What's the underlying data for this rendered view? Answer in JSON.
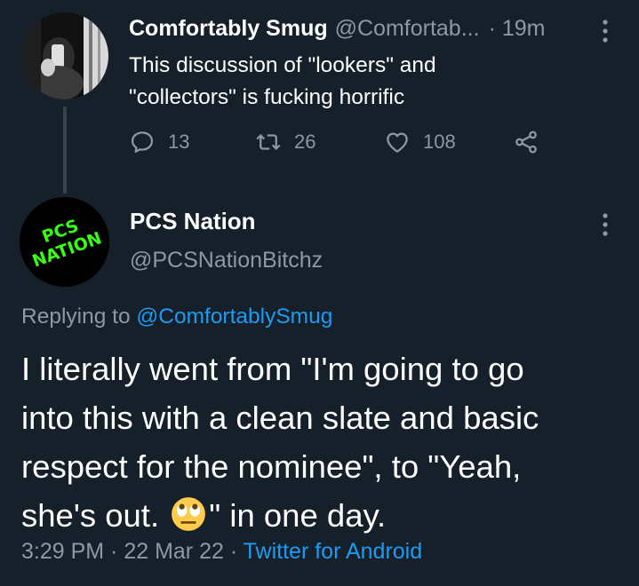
{
  "parent_tweet": {
    "display_name": "Comfortably Smug",
    "handle": "@Comfortab...",
    "time": "· 19m",
    "text_line1": "This discussion of \"lookers\" and",
    "text_line2": "\"collectors\" is fucking horrific",
    "replies": "13",
    "retweets": "26",
    "likes": "108"
  },
  "reply_tweet": {
    "display_name": "PCS Nation",
    "handle": "@PCSNationBitchz",
    "avatar_text_line1": "PCS",
    "avatar_text_line2": "NATION",
    "replying_prefix": "Replying to ",
    "replying_to": "@ComfortablySmug",
    "text_line1": "I literally went from \"I'm going to go",
    "text_line2": "into this with a clean slate and basic",
    "text_line3": "respect for the nominee\", to \"Yeah,",
    "text_line4_a": "she's out. ",
    "text_line4_b": "\" in one day.",
    "emoji": "eye-roll-emoji",
    "time": "3:29 PM",
    "separator": " · ",
    "date": "22 Mar 22",
    "source": "Twitter for Android"
  },
  "colors": {
    "background": "#15202b",
    "text_primary": "#ffffff",
    "text_secondary": "#8b98a5",
    "link": "#1d9bf0",
    "thread_line": "#38444d",
    "avatar_neon": "#39ff14"
  }
}
